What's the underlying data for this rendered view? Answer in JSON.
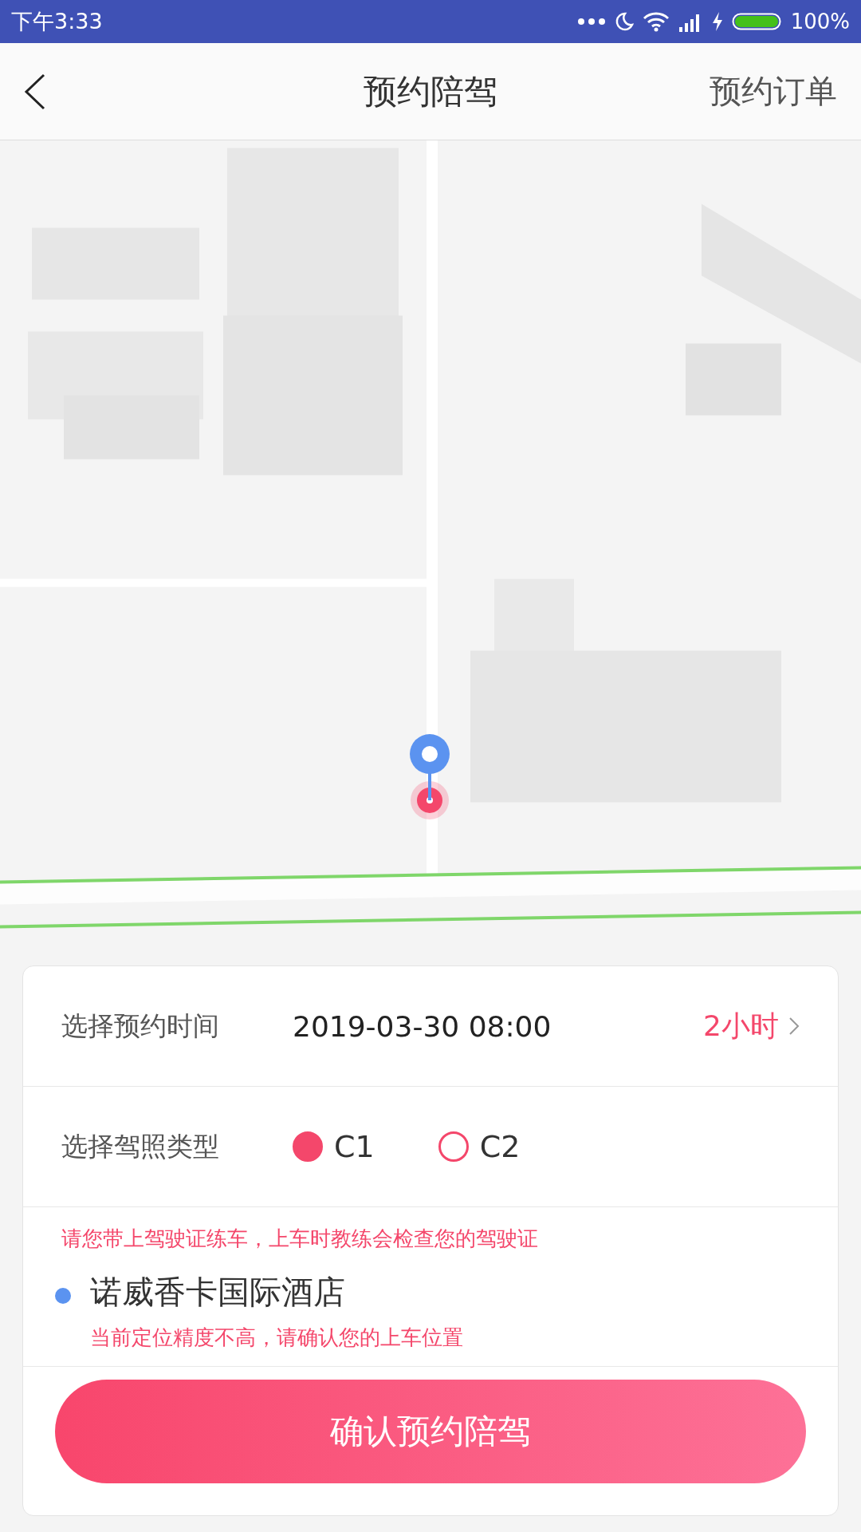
{
  "status_bar": {
    "time": "下午3:33",
    "battery": "100%"
  },
  "nav": {
    "title": "预约陪驾",
    "action": "预约订单"
  },
  "booking": {
    "time_row": {
      "label": "选择预约时间",
      "value": "2019-03-30 08:00",
      "duration": "2小时"
    },
    "license_row": {
      "label": "选择驾照类型",
      "options": [
        {
          "label": "C1",
          "selected": true
        },
        {
          "label": "C2",
          "selected": false
        }
      ]
    },
    "notice": "请您带上驾驶证练车，上车时教练会检查您的驾驶证",
    "location": {
      "name": "诺威香卡国际酒店",
      "hint": "当前定位精度不高，请确认您的上车位置"
    },
    "confirm_button": "确认预约陪驾"
  }
}
